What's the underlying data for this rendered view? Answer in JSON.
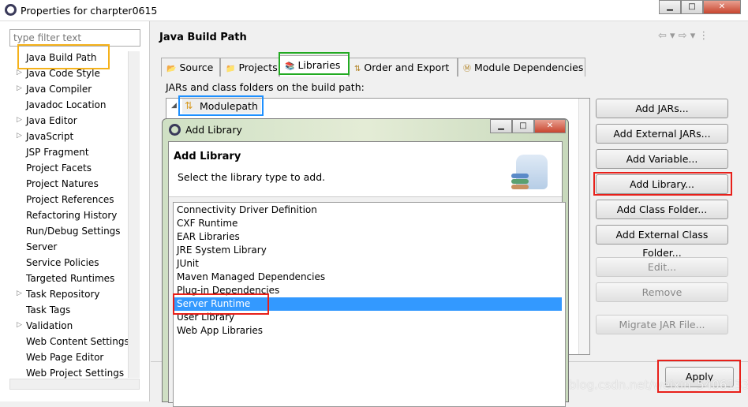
{
  "window": {
    "title": "Properties for charpter0615"
  },
  "left": {
    "filter_placeholder": "type filter text",
    "items": [
      {
        "label": "Java Build Path",
        "arrow": false
      },
      {
        "label": "Java Code Style",
        "arrow": true
      },
      {
        "label": "Java Compiler",
        "arrow": true
      },
      {
        "label": "Javadoc Location",
        "arrow": false
      },
      {
        "label": "Java Editor",
        "arrow": true
      },
      {
        "label": "JavaScript",
        "arrow": true
      },
      {
        "label": "JSP Fragment",
        "arrow": false
      },
      {
        "label": "Project Facets",
        "arrow": false
      },
      {
        "label": "Project Natures",
        "arrow": false
      },
      {
        "label": "Project References",
        "arrow": false
      },
      {
        "label": "Refactoring History",
        "arrow": false
      },
      {
        "label": "Run/Debug Settings",
        "arrow": false
      },
      {
        "label": "Server",
        "arrow": false
      },
      {
        "label": "Service Policies",
        "arrow": false
      },
      {
        "label": "Targeted Runtimes",
        "arrow": false
      },
      {
        "label": "Task Repository",
        "arrow": true
      },
      {
        "label": "Task Tags",
        "arrow": false
      },
      {
        "label": "Validation",
        "arrow": true
      },
      {
        "label": "Web Content Settings",
        "arrow": false
      },
      {
        "label": "Web Page Editor",
        "arrow": false
      },
      {
        "label": "Web Project Settings",
        "arrow": false
      }
    ]
  },
  "main": {
    "title": "Java Build Path",
    "tabs": [
      "Source",
      "Projects",
      "Libraries",
      "Order and Export",
      "Module Dependencies"
    ],
    "selected_tab": "Libraries",
    "section_label": "JARs and class folders on the build path:",
    "tree_root": "Modulepath",
    "buttons": [
      {
        "label": "Add JARs...",
        "enabled": true
      },
      {
        "label": "Add External JARs...",
        "enabled": true
      },
      {
        "label": "Add Variable...",
        "enabled": true
      },
      {
        "label": "Add Library...",
        "enabled": true
      },
      {
        "label": "Add Class Folder...",
        "enabled": true
      },
      {
        "label": "Add External Class Folder...",
        "enabled": true
      },
      {
        "label": "Edit...",
        "enabled": false
      },
      {
        "label": "Remove",
        "enabled": false
      },
      {
        "label": "Migrate JAR File...",
        "enabled": false
      }
    ],
    "apply": "Apply"
  },
  "dialog": {
    "title": "Add Library",
    "heading": "Add Library",
    "description": "Select the library type to add.",
    "items": [
      "Connectivity Driver Definition",
      "CXF Runtime",
      "EAR Libraries",
      "JRE System Library",
      "JUnit",
      "Maven Managed Dependencies",
      "Plug-in Dependencies",
      "Server Runtime",
      "User Library",
      "Web App Libraries"
    ],
    "selected": "Server Runtime"
  },
  "watermark": "https://blog.csdn.net/weixin_54061333",
  "colors": {
    "selection": "#3399ff",
    "highlight_red": "#e8201a",
    "highlight_orange": "#f5b21b",
    "highlight_green": "#22aa22",
    "highlight_blue": "#1e90ff"
  }
}
